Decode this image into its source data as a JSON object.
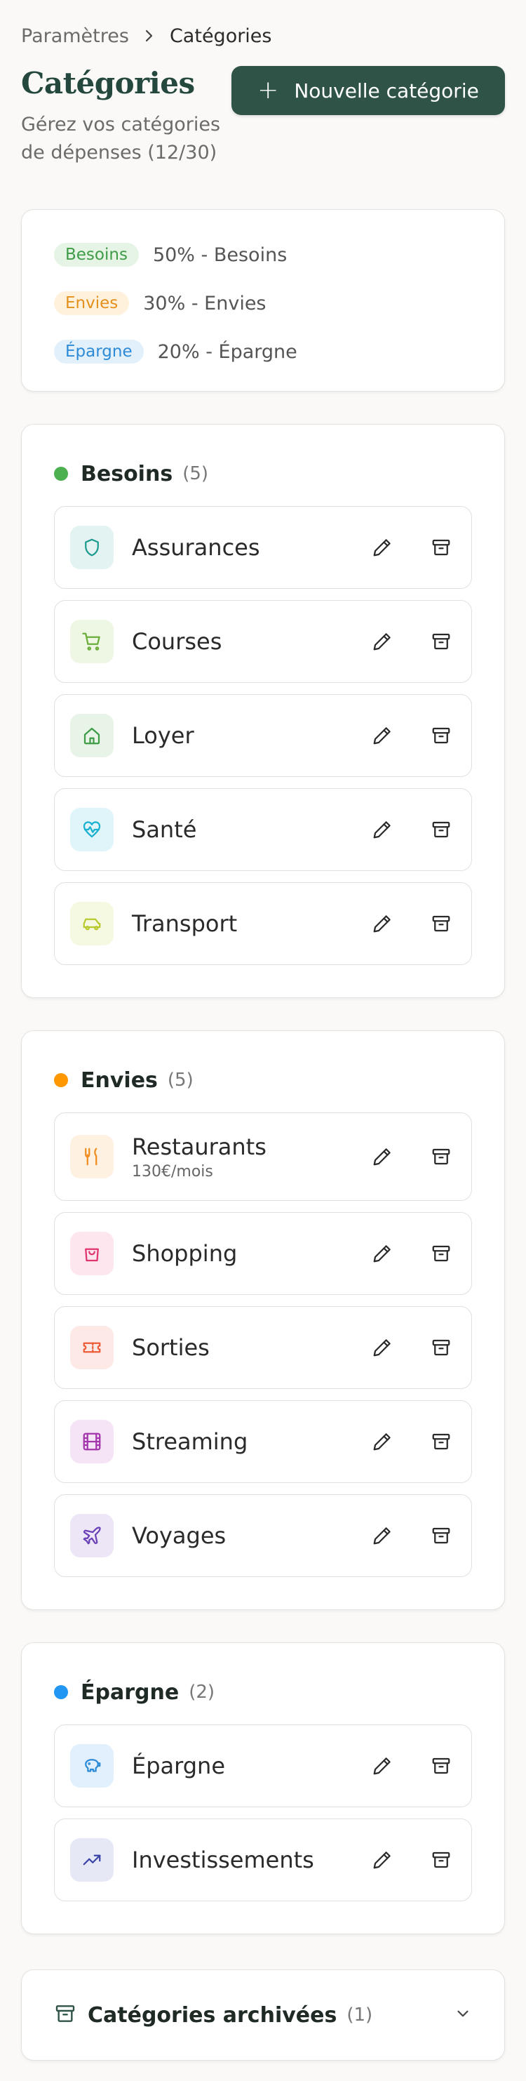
{
  "breadcrumb": {
    "parent": "Paramètres",
    "current": "Catégories"
  },
  "header": {
    "title": "Catégories",
    "subtitle": "Gérez vos catégories de dépenses (12/30)",
    "new_button": "Nouvelle catégorie"
  },
  "legend": [
    {
      "pill": "Besoins",
      "text": "50% - Besoins",
      "pill_bg": "#e6f4e6",
      "pill_color": "#3e9b46"
    },
    {
      "pill": "Envies",
      "text": "30% - Envies",
      "pill_bg": "#fff1dc",
      "pill_color": "#e3901c"
    },
    {
      "pill": "Épargne",
      "text": "20% - Épargne",
      "pill_bg": "#e2f0fc",
      "pill_color": "#2d8ad6"
    }
  ],
  "groups": [
    {
      "name": "Besoins",
      "count": "(5)",
      "color": "#4caf50",
      "items": [
        {
          "name": "Assurances",
          "icon": "shield-icon",
          "bg": "#e3f3f1",
          "fg": "#1e9b8f"
        },
        {
          "name": "Courses",
          "icon": "cart-icon",
          "bg": "#eef6e4",
          "fg": "#6aad3a"
        },
        {
          "name": "Loyer",
          "icon": "home-icon",
          "bg": "#e7f4e7",
          "fg": "#3e9b46"
        },
        {
          "name": "Santé",
          "icon": "heart-pulse-icon",
          "bg": "#e0f5fa",
          "fg": "#1ab0cf"
        },
        {
          "name": "Transport",
          "icon": "car-icon",
          "bg": "#f6f9e1",
          "fg": "#b8c92e"
        }
      ]
    },
    {
      "name": "Envies",
      "count": "(5)",
      "color": "#ff9800",
      "items": [
        {
          "name": "Restaurants",
          "sub": "130€/mois",
          "icon": "utensils-icon",
          "bg": "#fff1e2",
          "fg": "#ef8c1d"
        },
        {
          "name": "Shopping",
          "icon": "shopping-bag-icon",
          "bg": "#fde6ee",
          "fg": "#e0356d"
        },
        {
          "name": "Sorties",
          "icon": "ticket-icon",
          "bg": "#fde9e5",
          "fg": "#ee5b38"
        },
        {
          "name": "Streaming",
          "icon": "film-icon",
          "bg": "#f4e4f5",
          "fg": "#a336ad"
        },
        {
          "name": "Voyages",
          "icon": "plane-icon",
          "bg": "#ece6f6",
          "fg": "#6a3fb8"
        }
      ]
    },
    {
      "name": "Épargne",
      "count": "(2)",
      "color": "#2196f3",
      "items": [
        {
          "name": "Épargne",
          "icon": "piggy-bank-icon",
          "bg": "#e1f0fc",
          "fg": "#2d8ad6"
        },
        {
          "name": "Investissements",
          "icon": "trending-up-icon",
          "bg": "#e6e8f6",
          "fg": "#3b46a8"
        }
      ]
    }
  ],
  "archived": {
    "title": "Catégories archivées",
    "count": "(1)"
  }
}
